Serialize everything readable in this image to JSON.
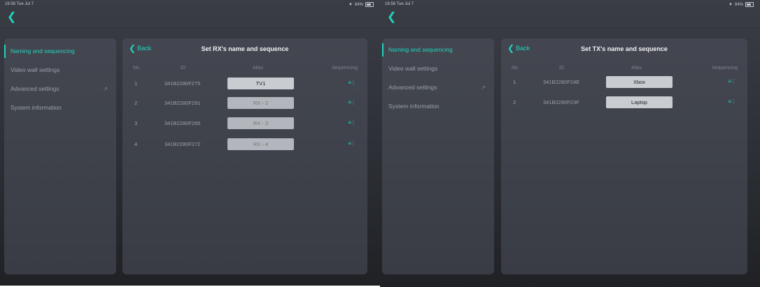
{
  "screens": [
    {
      "status": {
        "time": "16:58  Tue Jul 7",
        "battery": "84%"
      },
      "sidebar": {
        "items": [
          {
            "label": "Naming and sequencing",
            "active": true
          },
          {
            "label": "Video wall settings"
          },
          {
            "label": "Advanced settings"
          },
          {
            "label": "System information"
          }
        ]
      },
      "panel": {
        "back_label": "Back",
        "title": "Set RX's name and sequence",
        "columns": [
          "No.",
          "ID",
          "Alias",
          "Sequencing"
        ],
        "rows": [
          {
            "no": "1",
            "id": "341B2280F275",
            "alias": "TV1",
            "placeholder": ""
          },
          {
            "no": "2",
            "id": "341B2280F291",
            "alias": "",
            "placeholder": "RX - 2"
          },
          {
            "no": "3",
            "id": "341B2280F265",
            "alias": "",
            "placeholder": "RX - 3"
          },
          {
            "no": "4",
            "id": "341B2280F272",
            "alias": "",
            "placeholder": "RX - 4"
          }
        ]
      }
    },
    {
      "status": {
        "time": "16:58  Tue Jul 7",
        "battery": "84%"
      },
      "sidebar": {
        "items": [
          {
            "label": "Naming and sequencing",
            "active": true
          },
          {
            "label": "Video wall settings"
          },
          {
            "label": "Advanced settings"
          },
          {
            "label": "System information"
          }
        ]
      },
      "panel": {
        "back_label": "Back",
        "title": "Set TX's name and sequence",
        "columns": [
          "No.",
          "ID",
          "Alias",
          "Sequencing"
        ],
        "rows": [
          {
            "no": "1",
            "id": "341B2280F24E",
            "alias": "Xbox",
            "placeholder": ""
          },
          {
            "no": "2",
            "id": "341B2280F23F",
            "alias": "Laptop",
            "placeholder": ""
          }
        ]
      }
    }
  ],
  "icons": {
    "nav_back": "chevron-left-icon",
    "panel_back": "chevron-left-icon",
    "sequencing": "drag-handle-icon",
    "advanced_settings": "external-link-icon"
  },
  "colors": {
    "accent": "#22d3bf",
    "panel": "#4e525c",
    "alias_box": "#c9ccd1"
  }
}
